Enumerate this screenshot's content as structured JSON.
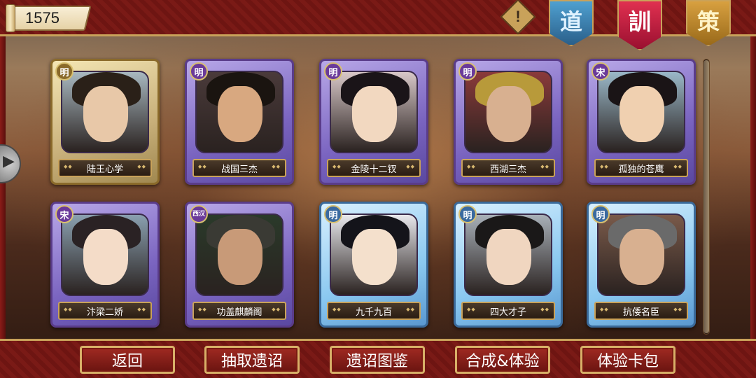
{
  "header": {
    "coin_value": "1575",
    "alert_icon": "!",
    "banners": [
      {
        "label": "道",
        "color": "#3a7ab0"
      },
      {
        "label": "訓",
        "color": "#c0204a"
      },
      {
        "label": "策",
        "color": "#c08a2a"
      }
    ]
  },
  "cards": [
    {
      "dynasty": "明",
      "name": "陆王心学",
      "frame": "gold"
    },
    {
      "dynasty": "明",
      "name": "战国三杰",
      "frame": "purple"
    },
    {
      "dynasty": "明",
      "name": "金陵十二钗",
      "frame": "purple"
    },
    {
      "dynasty": "明",
      "name": "西湖三杰",
      "frame": "purple"
    },
    {
      "dynasty": "宋",
      "name": "孤独的苍鹰",
      "frame": "purple"
    },
    {
      "dynasty": "宋",
      "name": "汴梁二娇",
      "frame": "purple"
    },
    {
      "dynasty": "西汉",
      "name": "功盖麒麟阁",
      "frame": "purple"
    },
    {
      "dynasty": "明",
      "name": "九千九百",
      "frame": "blue"
    },
    {
      "dynasty": "明",
      "name": "四大才子",
      "frame": "blue"
    },
    {
      "dynasty": "明",
      "name": "抗倭名臣",
      "frame": "blue"
    }
  ],
  "footer": {
    "buttons": [
      "返回",
      "抽取遗诏",
      "遗诏图鉴",
      "合成&体验",
      "体验卡包"
    ]
  },
  "colors": {
    "accent_gold": "#c9a25a",
    "bar_red": "#7a1a16",
    "card_purple": "#7a64c0",
    "card_blue": "#8ac8f0",
    "card_gold": "#c8b07a"
  }
}
